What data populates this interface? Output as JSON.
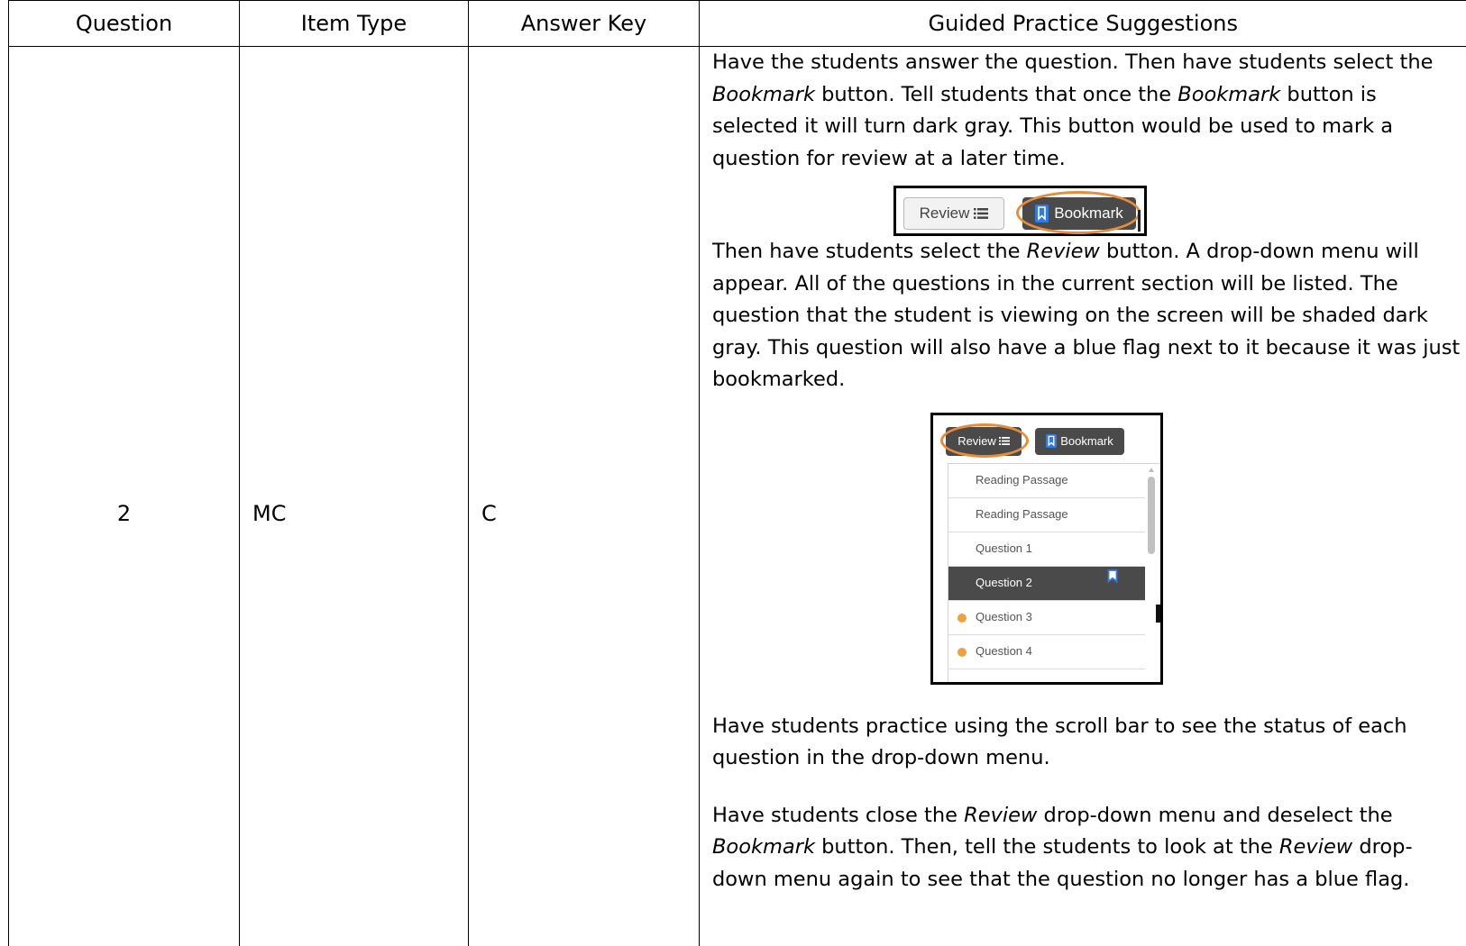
{
  "table": {
    "headers": [
      "Question",
      "Item Type",
      "Answer Key",
      "Guided Practice Suggestions"
    ],
    "row": {
      "question": "2",
      "item_type": "MC",
      "answer_key": "C"
    }
  },
  "guide": {
    "p1": {
      "a": "Have the students answer the question. Then have students select the ",
      "b": "Bookmark",
      "c": " button. Tell students that once the ",
      "d": "Bookmark",
      "e": " button is selected it will turn dark gray. This button would be used to mark a question for review at a later time."
    },
    "fig1": {
      "review_label": "Review",
      "bookmark_label": "Bookmark"
    },
    "p2": {
      "a": "Then have students select the ",
      "b": "Review",
      "c": " button. A drop-down menu will appear. All of the questions in the current section will be listed. The question that the student is viewing on the screen will be shaded dark gray. This question will also have a blue flag next to it because it was just bookmarked."
    },
    "fig2": {
      "review_label": "Review",
      "bookmark_label": "Bookmark",
      "items": [
        {
          "label": "Reading Passage"
        },
        {
          "label": "Reading Passage"
        },
        {
          "label": "Question 1"
        },
        {
          "label": "Question 2"
        },
        {
          "label": "Question 3"
        },
        {
          "label": "Question 4"
        }
      ]
    },
    "p3": "Have students practice using the scroll bar to see the status of each question in the drop-down menu.",
    "p4": {
      "a": "Have students close the ",
      "b": "Review",
      "c": " drop-down menu and deselect the ",
      "d": "Bookmark",
      "e": " button. Then, tell the students to look at the ",
      "f": "Review",
      "g": " drop-down menu again to see that the question no longer has a blue flag."
    }
  },
  "colors": {
    "highlight_ring": "#e88c3a",
    "dark_button": "#4a4a4a",
    "bookmark_blue": "#2f7be0",
    "status_dot": "#eea23f"
  },
  "icons": {
    "list_icon": "list-icon",
    "bookmark_icon": "bookmark-icon",
    "status_dot": "status-dot-icon"
  }
}
